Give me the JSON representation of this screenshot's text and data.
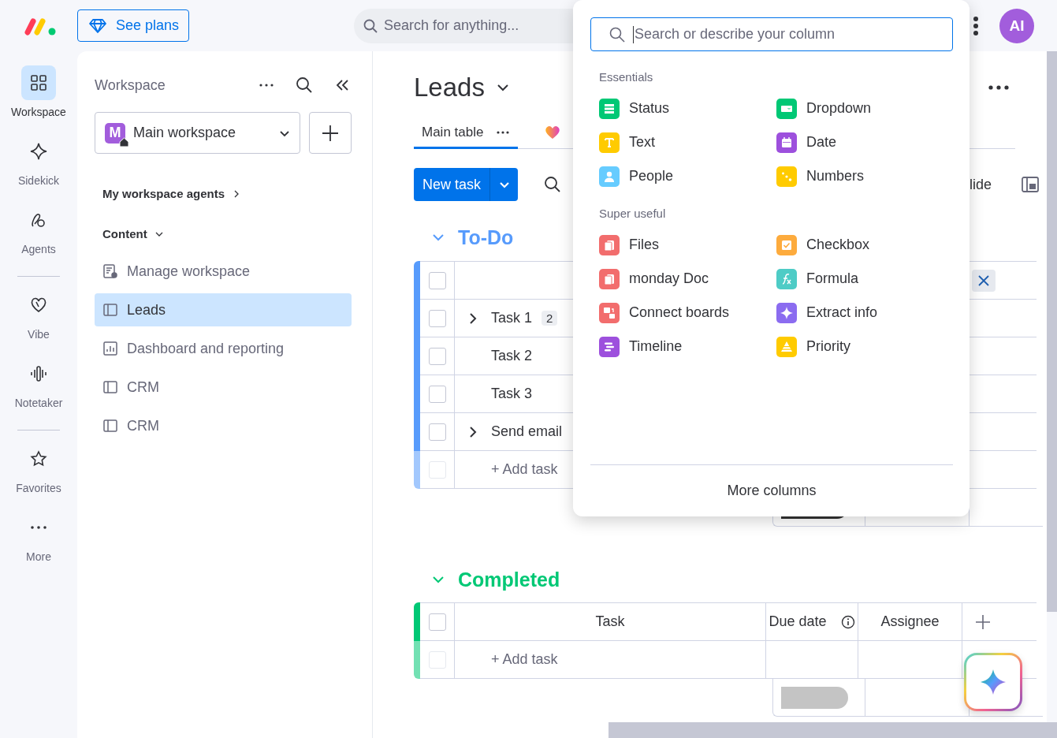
{
  "topbar": {
    "plans_button": "See plans",
    "search": {
      "placeholder": "Search for anything..."
    },
    "avatar": "AI"
  },
  "rail": {
    "groups": [
      {
        "items": [
          {
            "label": "Workspace",
            "kind": "grid",
            "selected": true
          },
          {
            "label": "Sidekick",
            "kind": "sparkle",
            "selected": false
          },
          {
            "label": "Agents",
            "kind": "agents",
            "selected": false
          }
        ]
      },
      {
        "items": [
          {
            "label": "Vibe",
            "kind": "heart",
            "selected": false
          },
          {
            "label": "Notetaker",
            "kind": "wave",
            "selected": false
          }
        ]
      },
      {
        "items": [
          {
            "label": "Favorites",
            "kind": "star",
            "selected": false
          },
          {
            "label": "More",
            "kind": "dots",
            "selected": false
          }
        ]
      }
    ]
  },
  "sidebar": {
    "title": "Workspace",
    "workspace": {
      "initial": "M",
      "name": "Main workspace"
    },
    "agents_link": "My workspace agents",
    "content_label": "Content",
    "items": [
      {
        "label": "Manage workspace",
        "kind": "manage",
        "selected": false
      },
      {
        "label": "Leads",
        "kind": "board",
        "selected": true
      },
      {
        "label": "Dashboard and reporting",
        "kind": "dashboard",
        "selected": false
      },
      {
        "label": "CRM",
        "kind": "board",
        "selected": false
      },
      {
        "label": "CRM",
        "kind": "board",
        "selected": false
      }
    ]
  },
  "board": {
    "title": "Leads",
    "tabs": [
      {
        "label": "Main table",
        "kind": "table",
        "selected": true
      },
      {
        "kind": "vibe",
        "selected": false
      }
    ],
    "new_task": "New task",
    "toolbar_text": "lide",
    "groups": [
      {
        "name": "To-Do",
        "color": "#579bfc",
        "header_checkbox": {
          "checked": false
        },
        "add_checkbox": {
          "disabled": true
        },
        "summary": {
          "color": "#333333"
        },
        "add_label": "+ Add task",
        "tasks": [
          {
            "name": "Task 1",
            "has_subitems": true,
            "subitem_count": "2",
            "checked": false
          },
          {
            "name": "Task 2",
            "has_subitems": false,
            "checked": false
          },
          {
            "name": "Task 3",
            "has_subitems": false,
            "checked": false
          },
          {
            "name": "Send email",
            "has_subitems": true,
            "checked": false
          }
        ]
      },
      {
        "name": "Completed",
        "color": "#00c875",
        "header_checkbox": {
          "checked": false
        },
        "add_checkbox": {
          "disabled": true
        },
        "summary": {
          "color": "#c4c4c4"
        },
        "add_label": "+ Add task",
        "columns": [
          "Task",
          "Due date",
          "Assignee"
        ]
      }
    ]
  },
  "column_picker": {
    "search": {
      "placeholder": "Search or describe your column"
    },
    "sections": [
      {
        "title": "Essentials",
        "items": [
          {
            "label": "Status",
            "kind": "status",
            "color": "#00c875"
          },
          {
            "label": "Dropdown",
            "kind": "dropdown",
            "color": "#00c875"
          },
          {
            "label": "Text",
            "kind": "text",
            "color": "#ffcb00"
          },
          {
            "label": "Date",
            "kind": "date",
            "color": "#9d50dd"
          },
          {
            "label": "People",
            "kind": "people",
            "color": "#66ccff"
          },
          {
            "label": "Numbers",
            "kind": "numbers",
            "color": "#ffcb00"
          }
        ]
      },
      {
        "title": "Super useful",
        "items": [
          {
            "label": "Files",
            "kind": "files",
            "color": "#f26d6d"
          },
          {
            "label": "Checkbox",
            "kind": "checkbox",
            "color": "#fdab3d"
          },
          {
            "label": "monday Doc",
            "kind": "doc",
            "color": "#f26d6d"
          },
          {
            "label": "Formula",
            "kind": "formula",
            "color": "#4eccc6"
          },
          {
            "label": "Connect boards",
            "kind": "connect",
            "color": "#f26d6d"
          },
          {
            "label": "Extract info",
            "kind": "extract",
            "color": "#8b6cf0"
          },
          {
            "label": "Timeline",
            "kind": "timeline",
            "color": "#9d50dd"
          },
          {
            "label": "Priority",
            "kind": "priority",
            "color": "#ffcb00"
          }
        ]
      }
    ],
    "more": "More columns"
  }
}
